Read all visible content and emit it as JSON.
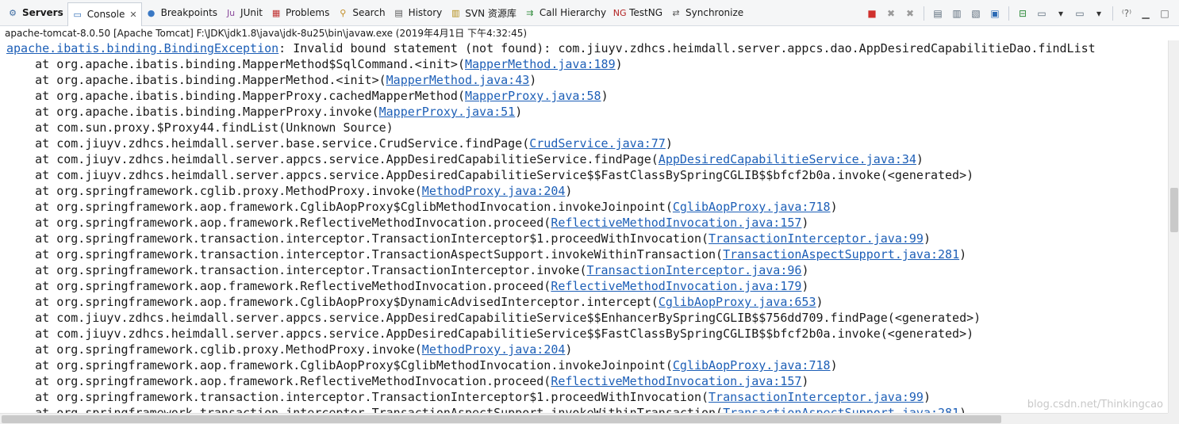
{
  "tabs": [
    {
      "label": "Servers",
      "icon": "servers-icon",
      "glyph": "⚙",
      "color": "#3b6aa0",
      "bold": true,
      "active": false
    },
    {
      "label": "Console",
      "icon": "console-icon",
      "glyph": "▭",
      "color": "#2d6bb5",
      "bold": false,
      "active": true
    },
    {
      "label": "Breakpoints",
      "icon": "breakpoints-icon",
      "glyph": "●",
      "color": "#3a78c4",
      "bold": false,
      "active": false
    },
    {
      "label": "JUnit",
      "icon": "junit-icon",
      "glyph": "Ju",
      "color": "#8a4a9c",
      "bold": false,
      "active": false
    },
    {
      "label": "Problems",
      "icon": "problems-icon",
      "glyph": "▦",
      "color": "#c03030",
      "bold": false,
      "active": false
    },
    {
      "label": "Search",
      "icon": "search-icon",
      "glyph": "⚲",
      "color": "#c08a20",
      "bold": false,
      "active": false
    },
    {
      "label": "History",
      "icon": "history-icon",
      "glyph": "▤",
      "color": "#555555",
      "bold": false,
      "active": false
    },
    {
      "label": "SVN 资源库",
      "icon": "svn-repository-icon",
      "glyph": "▥",
      "color": "#b08a10",
      "bold": false,
      "active": false
    },
    {
      "label": "Call Hierarchy",
      "icon": "call-hierarchy-icon",
      "glyph": "⇉",
      "color": "#2e8b3a",
      "bold": false,
      "active": false
    },
    {
      "label": "TestNG",
      "icon": "testng-icon",
      "glyph": "NG",
      "color": "#b22020",
      "bold": false,
      "active": false
    },
    {
      "label": "Synchronize",
      "icon": "synchronize-icon",
      "glyph": "⇄",
      "color": "#555555",
      "bold": false,
      "active": false
    }
  ],
  "toolbar": [
    {
      "name": "terminate-icon",
      "glyph": "■",
      "color": "#d0312d"
    },
    {
      "name": "remove-launch-icon",
      "glyph": "✖",
      "color": "#9a9a9a"
    },
    {
      "name": "remove-all-terminated-icon",
      "glyph": "✖",
      "color": "#9a9a9a"
    },
    {
      "sep": true
    },
    {
      "name": "clear-console-icon",
      "glyph": "▤",
      "color": "#5a6a7a"
    },
    {
      "name": "scroll-lock-icon",
      "glyph": "▥",
      "color": "#5a6a7a"
    },
    {
      "name": "word-wrap-icon",
      "glyph": "▧",
      "color": "#5a6a7a"
    },
    {
      "name": "show-console-icon",
      "glyph": "▣",
      "color": "#2d6bb5"
    },
    {
      "sep": true
    },
    {
      "name": "pin-console-icon",
      "glyph": "⊟",
      "color": "#2e8b3a"
    },
    {
      "name": "display-selected-console-icon",
      "glyph": "▭",
      "color": "#5a6a7a"
    },
    {
      "name": "display-selected-console-dropdown-icon",
      "glyph": "▾",
      "color": "#333333"
    },
    {
      "name": "open-console-icon",
      "glyph": "▭",
      "color": "#5a6a7a"
    },
    {
      "name": "open-console-dropdown-icon",
      "glyph": "▾",
      "color": "#333333"
    },
    {
      "sep": true
    },
    {
      "name": "view-menu-icon",
      "glyph": "⁽?⁾",
      "color": "#666666"
    },
    {
      "name": "minimize-icon",
      "glyph": "▁",
      "color": "#666666"
    },
    {
      "name": "maximize-icon",
      "glyph": "□",
      "color": "#666666"
    }
  ],
  "process": "apache-tomcat-8.0.50  [Apache Tomcat] F:\\JDK\\jdk1.8\\java\\jdk-8u25\\bin\\javaw.exe (2019年4月1日 下午4:32:45)",
  "console_lines": [
    {
      "indent": false,
      "prefix": "",
      "link": "apache.ibatis.binding.BindingException",
      "suffix": ": Invalid bound statement (not found): com.jiuyv.zdhcs.heimdall.server.appcs.dao.AppDesiredCapabilitieDao.findList"
    },
    {
      "indent": true,
      "prefix": "    at org.apache.ibatis.binding.MapperMethod$SqlCommand.<init>(",
      "link": "MapperMethod.java:189",
      "suffix": ")"
    },
    {
      "indent": true,
      "prefix": "    at org.apache.ibatis.binding.MapperMethod.<init>(",
      "link": "MapperMethod.java:43",
      "suffix": ")"
    },
    {
      "indent": true,
      "prefix": "    at org.apache.ibatis.binding.MapperProxy.cachedMapperMethod(",
      "link": "MapperProxy.java:58",
      "suffix": ")"
    },
    {
      "indent": true,
      "prefix": "    at org.apache.ibatis.binding.MapperProxy.invoke(",
      "link": "MapperProxy.java:51",
      "suffix": ")"
    },
    {
      "indent": true,
      "prefix": "    at com.sun.proxy.$Proxy44.findList(Unknown Source)",
      "link": "",
      "suffix": ""
    },
    {
      "indent": true,
      "prefix": "    at com.jiuyv.zdhcs.heimdall.server.base.service.CrudService.findPage(",
      "link": "CrudService.java:77",
      "suffix": ")"
    },
    {
      "indent": true,
      "prefix": "    at com.jiuyv.zdhcs.heimdall.server.appcs.service.AppDesiredCapabilitieService.findPage(",
      "link": "AppDesiredCapabilitieService.java:34",
      "suffix": ")"
    },
    {
      "indent": true,
      "prefix": "    at com.jiuyv.zdhcs.heimdall.server.appcs.service.AppDesiredCapabilitieService$$FastClassBySpringCGLIB$$bfcf2b0a.invoke(<generated>)",
      "link": "",
      "suffix": ""
    },
    {
      "indent": true,
      "prefix": "    at org.springframework.cglib.proxy.MethodProxy.invoke(",
      "link": "MethodProxy.java:204",
      "suffix": ")"
    },
    {
      "indent": true,
      "prefix": "    at org.springframework.aop.framework.CglibAopProxy$CglibMethodInvocation.invokeJoinpoint(",
      "link": "CglibAopProxy.java:718",
      "suffix": ")"
    },
    {
      "indent": true,
      "prefix": "    at org.springframework.aop.framework.ReflectiveMethodInvocation.proceed(",
      "link": "ReflectiveMethodInvocation.java:157",
      "suffix": ")"
    },
    {
      "indent": true,
      "prefix": "    at org.springframework.transaction.interceptor.TransactionInterceptor$1.proceedWithInvocation(",
      "link": "TransactionInterceptor.java:99",
      "suffix": ")"
    },
    {
      "indent": true,
      "prefix": "    at org.springframework.transaction.interceptor.TransactionAspectSupport.invokeWithinTransaction(",
      "link": "TransactionAspectSupport.java:281",
      "suffix": ")"
    },
    {
      "indent": true,
      "prefix": "    at org.springframework.transaction.interceptor.TransactionInterceptor.invoke(",
      "link": "TransactionInterceptor.java:96",
      "suffix": ")"
    },
    {
      "indent": true,
      "prefix": "    at org.springframework.aop.framework.ReflectiveMethodInvocation.proceed(",
      "link": "ReflectiveMethodInvocation.java:179",
      "suffix": ")"
    },
    {
      "indent": true,
      "prefix": "    at org.springframework.aop.framework.CglibAopProxy$DynamicAdvisedInterceptor.intercept(",
      "link": "CglibAopProxy.java:653",
      "suffix": ")"
    },
    {
      "indent": true,
      "prefix": "    at com.jiuyv.zdhcs.heimdall.server.appcs.service.AppDesiredCapabilitieService$$EnhancerBySpringCGLIB$$756dd709.findPage(<generated>)",
      "link": "",
      "suffix": ""
    },
    {
      "indent": true,
      "prefix": "    at com.jiuyv.zdhcs.heimdall.server.appcs.service.AppDesiredCapabilitieService$$FastClassBySpringCGLIB$$bfcf2b0a.invoke(<generated>)",
      "link": "",
      "suffix": ""
    },
    {
      "indent": true,
      "prefix": "    at org.springframework.cglib.proxy.MethodProxy.invoke(",
      "link": "MethodProxy.java:204",
      "suffix": ")"
    },
    {
      "indent": true,
      "prefix": "    at org.springframework.aop.framework.CglibAopProxy$CglibMethodInvocation.invokeJoinpoint(",
      "link": "CglibAopProxy.java:718",
      "suffix": ")"
    },
    {
      "indent": true,
      "prefix": "    at org.springframework.aop.framework.ReflectiveMethodInvocation.proceed(",
      "link": "ReflectiveMethodInvocation.java:157",
      "suffix": ")"
    },
    {
      "indent": true,
      "prefix": "    at org.springframework.transaction.interceptor.TransactionInterceptor$1.proceedWithInvocation(",
      "link": "TransactionInterceptor.java:99",
      "suffix": ")"
    },
    {
      "indent": true,
      "prefix": "    at org.springframework.transaction.interceptor.TransactionAspectSupport.invokeWithinTransaction(",
      "link": "TransactionAspectSupport.java:281",
      "suffix": ")"
    }
  ],
  "watermark": "blog.csdn.net/Thinkingcao",
  "colors": {
    "link": "#1d5fb7",
    "text": "#1a1a1a",
    "tabbar": "#f5f6f7"
  }
}
